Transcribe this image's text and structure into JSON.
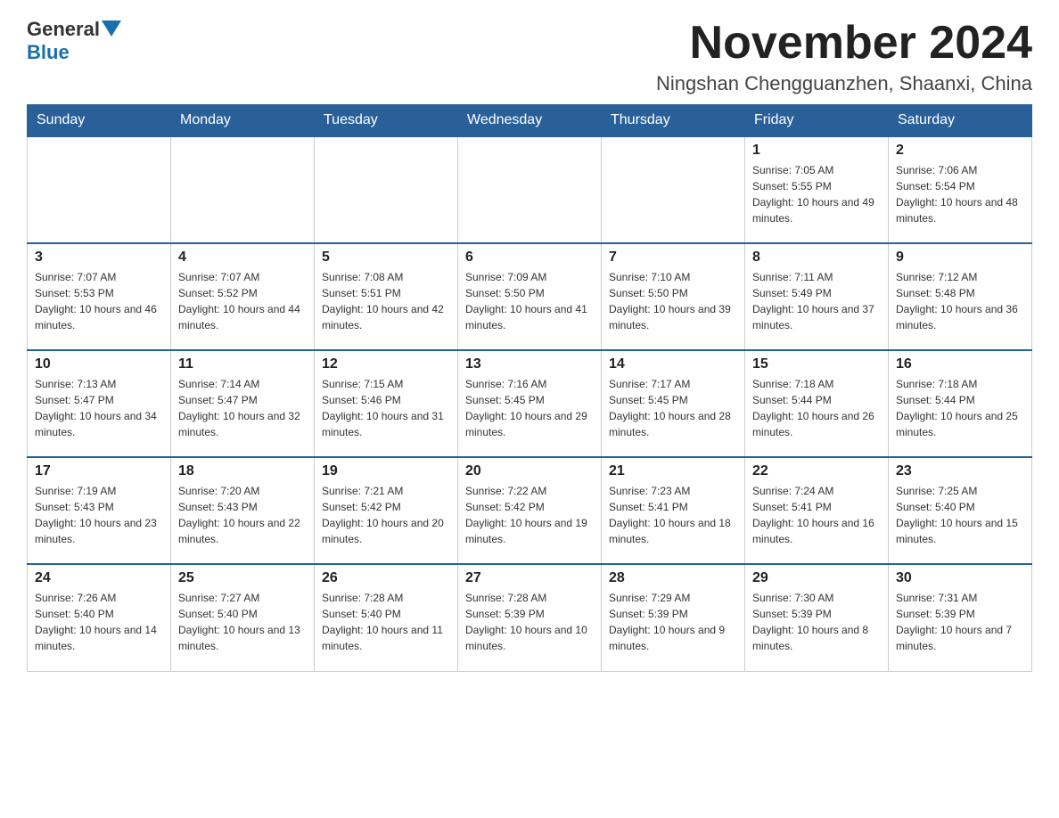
{
  "header": {
    "logo_general": "General",
    "logo_blue": "Blue",
    "month_title": "November 2024",
    "location": "Ningshan Chengguanzhen, Shaanxi, China"
  },
  "weekdays": [
    "Sunday",
    "Monday",
    "Tuesday",
    "Wednesday",
    "Thursday",
    "Friday",
    "Saturday"
  ],
  "weeks": [
    [
      {
        "day": "",
        "info": ""
      },
      {
        "day": "",
        "info": ""
      },
      {
        "day": "",
        "info": ""
      },
      {
        "day": "",
        "info": ""
      },
      {
        "day": "",
        "info": ""
      },
      {
        "day": "1",
        "info": "Sunrise: 7:05 AM\nSunset: 5:55 PM\nDaylight: 10 hours and 49 minutes."
      },
      {
        "day": "2",
        "info": "Sunrise: 7:06 AM\nSunset: 5:54 PM\nDaylight: 10 hours and 48 minutes."
      }
    ],
    [
      {
        "day": "3",
        "info": "Sunrise: 7:07 AM\nSunset: 5:53 PM\nDaylight: 10 hours and 46 minutes."
      },
      {
        "day": "4",
        "info": "Sunrise: 7:07 AM\nSunset: 5:52 PM\nDaylight: 10 hours and 44 minutes."
      },
      {
        "day": "5",
        "info": "Sunrise: 7:08 AM\nSunset: 5:51 PM\nDaylight: 10 hours and 42 minutes."
      },
      {
        "day": "6",
        "info": "Sunrise: 7:09 AM\nSunset: 5:50 PM\nDaylight: 10 hours and 41 minutes."
      },
      {
        "day": "7",
        "info": "Sunrise: 7:10 AM\nSunset: 5:50 PM\nDaylight: 10 hours and 39 minutes."
      },
      {
        "day": "8",
        "info": "Sunrise: 7:11 AM\nSunset: 5:49 PM\nDaylight: 10 hours and 37 minutes."
      },
      {
        "day": "9",
        "info": "Sunrise: 7:12 AM\nSunset: 5:48 PM\nDaylight: 10 hours and 36 minutes."
      }
    ],
    [
      {
        "day": "10",
        "info": "Sunrise: 7:13 AM\nSunset: 5:47 PM\nDaylight: 10 hours and 34 minutes."
      },
      {
        "day": "11",
        "info": "Sunrise: 7:14 AM\nSunset: 5:47 PM\nDaylight: 10 hours and 32 minutes."
      },
      {
        "day": "12",
        "info": "Sunrise: 7:15 AM\nSunset: 5:46 PM\nDaylight: 10 hours and 31 minutes."
      },
      {
        "day": "13",
        "info": "Sunrise: 7:16 AM\nSunset: 5:45 PM\nDaylight: 10 hours and 29 minutes."
      },
      {
        "day": "14",
        "info": "Sunrise: 7:17 AM\nSunset: 5:45 PM\nDaylight: 10 hours and 28 minutes."
      },
      {
        "day": "15",
        "info": "Sunrise: 7:18 AM\nSunset: 5:44 PM\nDaylight: 10 hours and 26 minutes."
      },
      {
        "day": "16",
        "info": "Sunrise: 7:18 AM\nSunset: 5:44 PM\nDaylight: 10 hours and 25 minutes."
      }
    ],
    [
      {
        "day": "17",
        "info": "Sunrise: 7:19 AM\nSunset: 5:43 PM\nDaylight: 10 hours and 23 minutes."
      },
      {
        "day": "18",
        "info": "Sunrise: 7:20 AM\nSunset: 5:43 PM\nDaylight: 10 hours and 22 minutes."
      },
      {
        "day": "19",
        "info": "Sunrise: 7:21 AM\nSunset: 5:42 PM\nDaylight: 10 hours and 20 minutes."
      },
      {
        "day": "20",
        "info": "Sunrise: 7:22 AM\nSunset: 5:42 PM\nDaylight: 10 hours and 19 minutes."
      },
      {
        "day": "21",
        "info": "Sunrise: 7:23 AM\nSunset: 5:41 PM\nDaylight: 10 hours and 18 minutes."
      },
      {
        "day": "22",
        "info": "Sunrise: 7:24 AM\nSunset: 5:41 PM\nDaylight: 10 hours and 16 minutes."
      },
      {
        "day": "23",
        "info": "Sunrise: 7:25 AM\nSunset: 5:40 PM\nDaylight: 10 hours and 15 minutes."
      }
    ],
    [
      {
        "day": "24",
        "info": "Sunrise: 7:26 AM\nSunset: 5:40 PM\nDaylight: 10 hours and 14 minutes."
      },
      {
        "day": "25",
        "info": "Sunrise: 7:27 AM\nSunset: 5:40 PM\nDaylight: 10 hours and 13 minutes."
      },
      {
        "day": "26",
        "info": "Sunrise: 7:28 AM\nSunset: 5:40 PM\nDaylight: 10 hours and 11 minutes."
      },
      {
        "day": "27",
        "info": "Sunrise: 7:28 AM\nSunset: 5:39 PM\nDaylight: 10 hours and 10 minutes."
      },
      {
        "day": "28",
        "info": "Sunrise: 7:29 AM\nSunset: 5:39 PM\nDaylight: 10 hours and 9 minutes."
      },
      {
        "day": "29",
        "info": "Sunrise: 7:30 AM\nSunset: 5:39 PM\nDaylight: 10 hours and 8 minutes."
      },
      {
        "day": "30",
        "info": "Sunrise: 7:31 AM\nSunset: 5:39 PM\nDaylight: 10 hours and 7 minutes."
      }
    ]
  ]
}
